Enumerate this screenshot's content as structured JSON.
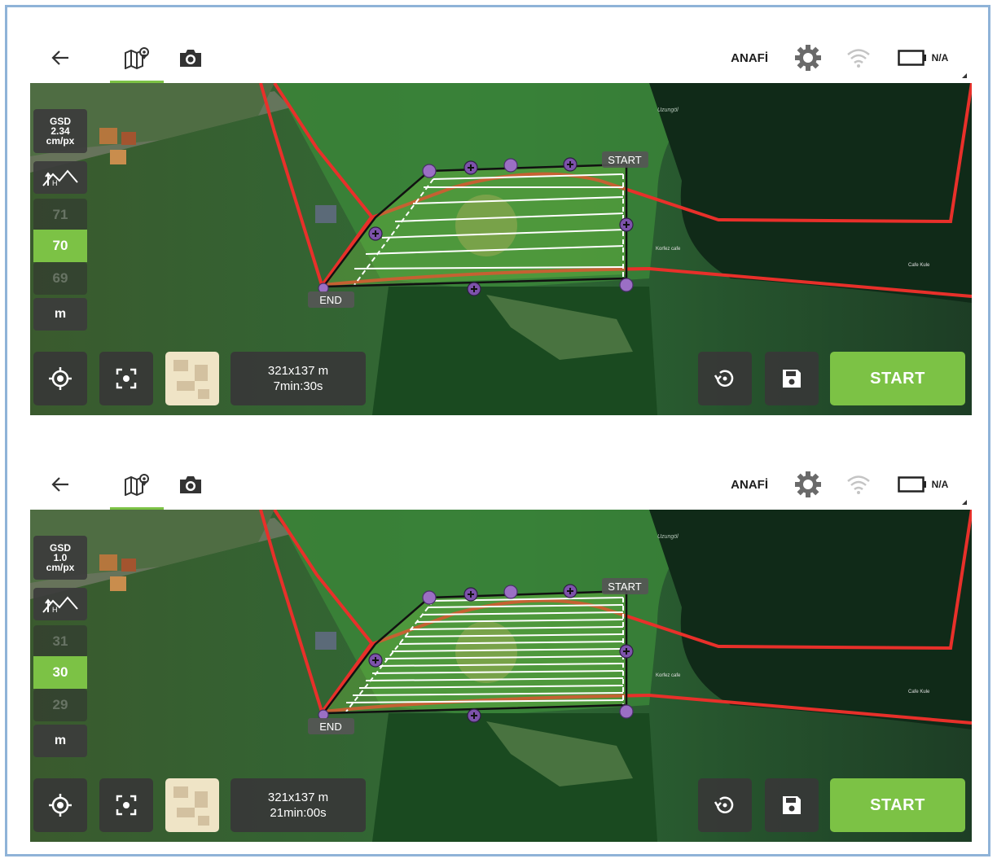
{
  "screens": [
    {
      "topbar": {
        "drone_name": "ANAFİ",
        "battery_label": "N/A"
      },
      "map": {
        "start_label": "START",
        "end_label": "END",
        "poi_cafe1": "Korfez cafe",
        "poi_cafe2": "Cafe Kule",
        "poi_lake": "Uzungöl"
      },
      "gsd": {
        "title": "GSD",
        "value": "2.34",
        "unit": "cm/px"
      },
      "altitude": {
        "prev": "71",
        "current": "70",
        "next": "69",
        "unit": "m"
      },
      "plan": {
        "size": "321x137 m",
        "duration": "7min:30s"
      },
      "start_button": "START"
    },
    {
      "topbar": {
        "drone_name": "ANAFİ",
        "battery_label": "N/A"
      },
      "map": {
        "start_label": "START",
        "end_label": "END",
        "poi_cafe1": "Korfez cafe",
        "poi_cafe2": "Cafe Kule",
        "poi_lake": "Uzungöl"
      },
      "gsd": {
        "title": "GSD",
        "value": "1.0",
        "unit": "cm/px"
      },
      "altitude": {
        "prev": "31",
        "current": "30",
        "next": "29",
        "unit": "m"
      },
      "plan": {
        "size": "321x137 m",
        "duration": "21min:00s"
      },
      "start_button": "START"
    }
  ],
  "colors": {
    "accent": "#7cc245",
    "boundary": "#e8302a",
    "waypoint": "#9b6fc4",
    "panel": "#3c3c3c"
  },
  "icons": [
    "back-arrow-icon",
    "map-pin-icon",
    "camera-icon",
    "gear-icon",
    "wifi-icon",
    "battery-icon",
    "altitude-icon",
    "locate-icon",
    "fit-view-icon",
    "reset-icon",
    "save-icon"
  ]
}
